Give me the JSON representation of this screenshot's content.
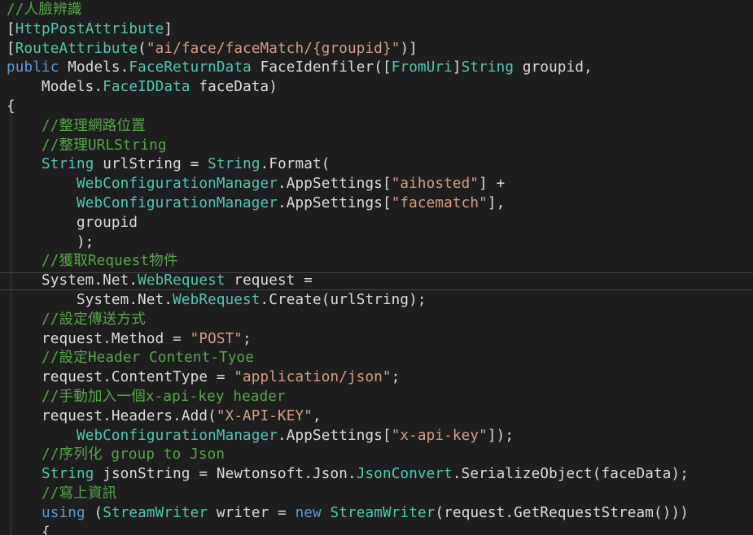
{
  "editor": {
    "colors": {
      "background": "#1e1e1e",
      "comment": "#57a64a",
      "keyword": "#569cd6",
      "type": "#4ec9b0",
      "string": "#d69d85",
      "plain": "#dcdcdc"
    },
    "lines": [
      [
        {
          "t": "//人臉辨識",
          "c": "comment"
        }
      ],
      [
        {
          "t": "[",
          "c": "plain"
        },
        {
          "t": "HttpPostAttribute",
          "c": "type"
        },
        {
          "t": "]",
          "c": "plain"
        }
      ],
      [
        {
          "t": "[",
          "c": "plain"
        },
        {
          "t": "RouteAttribute",
          "c": "type"
        },
        {
          "t": "(",
          "c": "plain"
        },
        {
          "t": "\"ai/face/faceMatch/{groupid}\"",
          "c": "str"
        },
        {
          "t": ")]",
          "c": "plain"
        }
      ],
      [
        {
          "t": "public",
          "c": "kw"
        },
        {
          "t": " Models.",
          "c": "plain"
        },
        {
          "t": "FaceReturnData",
          "c": "type"
        },
        {
          "t": " FaceIdenfiler([",
          "c": "plain"
        },
        {
          "t": "FromUri",
          "c": "type"
        },
        {
          "t": "]",
          "c": "plain"
        },
        {
          "t": "String",
          "c": "type"
        },
        {
          "t": " groupid,",
          "c": "plain"
        }
      ],
      [
        {
          "t": "    Models.",
          "c": "plain"
        },
        {
          "t": "FaceIDData",
          "c": "type"
        },
        {
          "t": " faceData)",
          "c": "plain"
        }
      ],
      [
        {
          "t": "{",
          "c": "plain"
        }
      ],
      [
        {
          "t": "    //整理網路位置",
          "c": "comment"
        }
      ],
      [
        {
          "t": "    //整理URLString",
          "c": "comment"
        }
      ],
      [
        {
          "t": "    ",
          "c": "plain"
        },
        {
          "t": "String",
          "c": "type"
        },
        {
          "t": " urlString = ",
          "c": "plain"
        },
        {
          "t": "String",
          "c": "type"
        },
        {
          "t": ".Format(",
          "c": "plain"
        }
      ],
      [
        {
          "t": "        ",
          "c": "plain"
        },
        {
          "t": "WebConfigurationManager",
          "c": "type"
        },
        {
          "t": ".AppSettings[",
          "c": "plain"
        },
        {
          "t": "\"aihosted\"",
          "c": "str"
        },
        {
          "t": "] +",
          "c": "plain"
        }
      ],
      [
        {
          "t": "        ",
          "c": "plain"
        },
        {
          "t": "WebConfigurationManager",
          "c": "type"
        },
        {
          "t": ".AppSettings[",
          "c": "plain"
        },
        {
          "t": "\"facematch\"",
          "c": "str"
        },
        {
          "t": "],",
          "c": "plain"
        }
      ],
      [
        {
          "t": "        groupid",
          "c": "plain"
        }
      ],
      [
        {
          "t": "        );",
          "c": "plain"
        }
      ],
      [
        {
          "t": "    //獲取Request物件",
          "c": "comment"
        }
      ],
      [
        {
          "t": "    System.Net.",
          "c": "plain"
        },
        {
          "t": "WebRequest",
          "c": "type"
        },
        {
          "t": " request =",
          "c": "plain"
        }
      ],
      [
        {
          "t": "        System.Net.",
          "c": "plain"
        },
        {
          "t": "WebRequest",
          "c": "type"
        },
        {
          "t": ".Create(urlString);",
          "c": "plain"
        }
      ],
      [
        {
          "t": "    //設定傳送方式",
          "c": "comment"
        }
      ],
      [
        {
          "t": "    request.Method = ",
          "c": "plain"
        },
        {
          "t": "\"POST\"",
          "c": "str"
        },
        {
          "t": ";",
          "c": "plain"
        }
      ],
      [
        {
          "t": "    //設定Header Content-Tyoe",
          "c": "comment"
        }
      ],
      [
        {
          "t": "    request.ContentType = ",
          "c": "plain"
        },
        {
          "t": "\"application/json\"",
          "c": "str"
        },
        {
          "t": ";",
          "c": "plain"
        }
      ],
      [
        {
          "t": "    //手動加入一個x-api-key header",
          "c": "comment"
        }
      ],
      [
        {
          "t": "    request.Headers.Add(",
          "c": "plain"
        },
        {
          "t": "\"X-API-KEY\"",
          "c": "str"
        },
        {
          "t": ",",
          "c": "plain"
        }
      ],
      [
        {
          "t": "        ",
          "c": "plain"
        },
        {
          "t": "WebConfigurationManager",
          "c": "type"
        },
        {
          "t": ".AppSettings[",
          "c": "plain"
        },
        {
          "t": "\"x-api-key\"",
          "c": "str"
        },
        {
          "t": "]);",
          "c": "plain"
        }
      ],
      [
        {
          "t": "    //序列化 group to Json",
          "c": "comment"
        }
      ],
      [
        {
          "t": "    ",
          "c": "plain"
        },
        {
          "t": "String",
          "c": "type"
        },
        {
          "t": " jsonString = Newtonsoft.Json.",
          "c": "plain"
        },
        {
          "t": "JsonConvert",
          "c": "type"
        },
        {
          "t": ".SerializeObject(faceData);",
          "c": "plain"
        }
      ],
      [
        {
          "t": "    //寫上資訊",
          "c": "comment"
        }
      ],
      [
        {
          "t": "    ",
          "c": "plain"
        },
        {
          "t": "using",
          "c": "kw"
        },
        {
          "t": " (",
          "c": "plain"
        },
        {
          "t": "StreamWriter",
          "c": "type"
        },
        {
          "t": " writer = ",
          "c": "plain"
        },
        {
          "t": "new",
          "c": "kw"
        },
        {
          "t": " ",
          "c": "plain"
        },
        {
          "t": "StreamWriter",
          "c": "type"
        },
        {
          "t": "(request.GetRequestStream()))",
          "c": "plain"
        }
      ],
      [
        {
          "t": "    {",
          "c": "plain"
        }
      ]
    ]
  }
}
